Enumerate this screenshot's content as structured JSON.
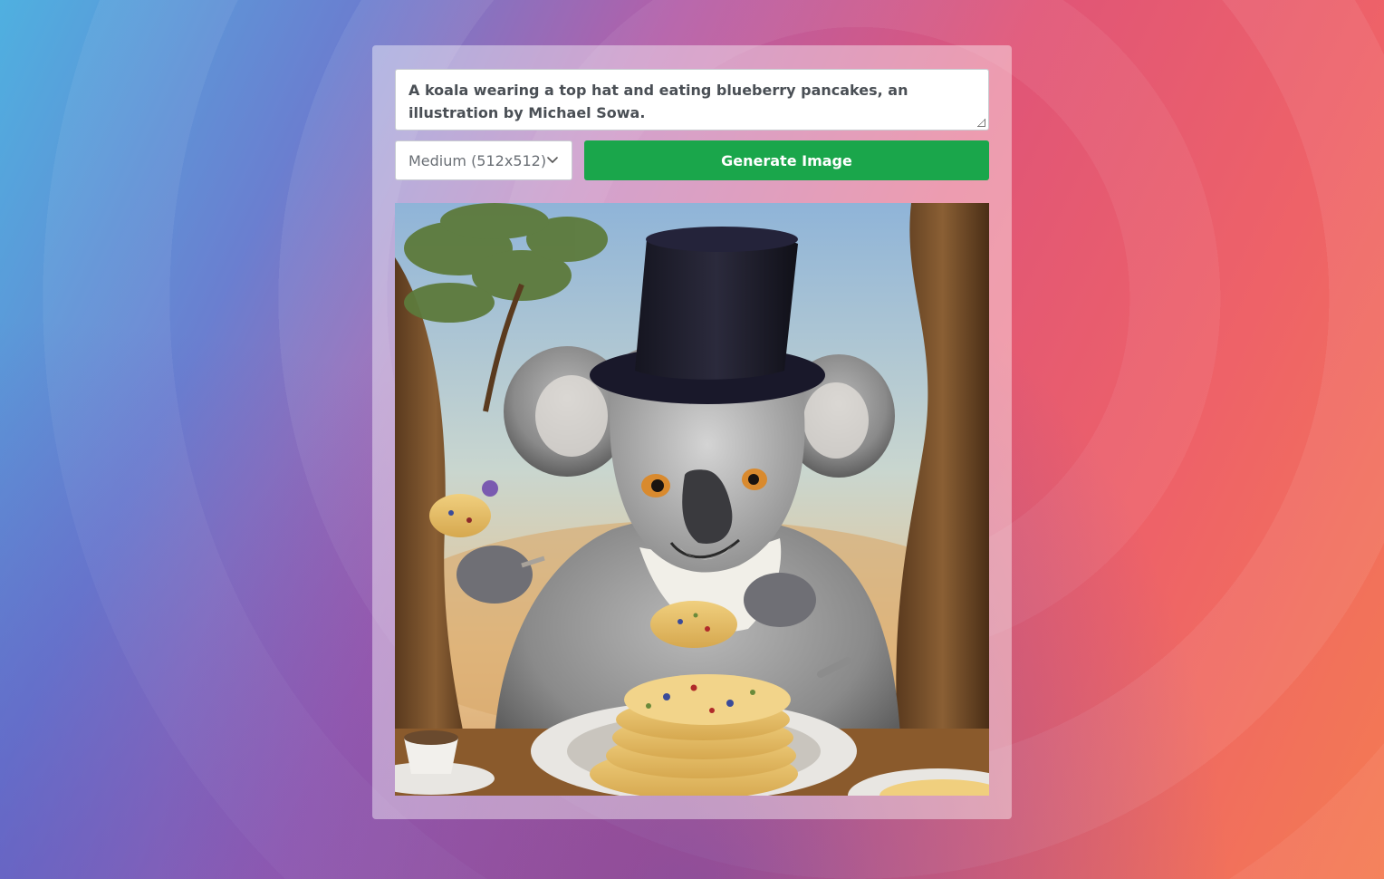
{
  "prompt": {
    "value": "A koala wearing a top hat and eating blueberry pancakes, an illustration by Michael Sowa."
  },
  "size_select": {
    "selected": "Medium (512x512)"
  },
  "generate_button": {
    "label": "Generate Image"
  },
  "generated_image": {
    "alt": "A koala wearing a top hat and eating blueberry pancakes"
  },
  "colors": {
    "button": "#1aa64b",
    "button_text": "#ffffff",
    "panel": "rgba(255,255,255,0.42)"
  }
}
